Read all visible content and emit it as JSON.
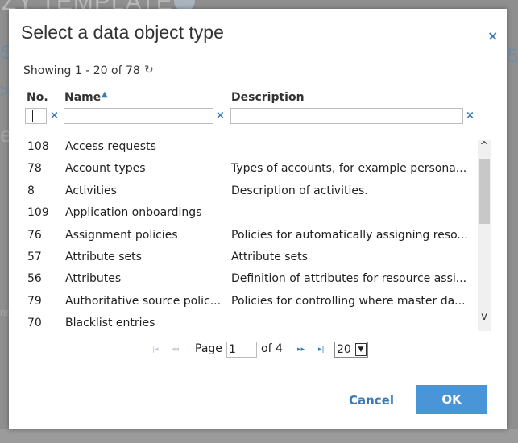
{
  "background": {
    "title_fragment": "ZY TEMPLATE",
    "left_s": "S",
    "left_gt": ">",
    "left_e": "e",
    "left_ns": "ns",
    "right_s": "5"
  },
  "dialog": {
    "title": "Select a data object type",
    "close_glyph": "×",
    "showing": "Showing 1 - 20 of 78",
    "refresh_glyph": "↻",
    "columns": {
      "no": "No.",
      "name": "Name",
      "description": "Description"
    },
    "filter_clear_glyph": "×",
    "rows": [
      {
        "no": "108",
        "name": "Access requests",
        "description": ""
      },
      {
        "no": "78",
        "name": "Account types",
        "description": "Types of accounts, for example persona..."
      },
      {
        "no": "8",
        "name": "Activities",
        "description": "Description of activities."
      },
      {
        "no": "109",
        "name": "Application onboardings",
        "description": ""
      },
      {
        "no": "76",
        "name": "Assignment policies",
        "description": "Policies for automatically assigning reso..."
      },
      {
        "no": "57",
        "name": "Attribute sets",
        "description": "Attribute sets"
      },
      {
        "no": "56",
        "name": "Attributes",
        "description": "Definition of attributes for resource assi..."
      },
      {
        "no": "79",
        "name": "Authoritative source polic...",
        "description": "Policies for controlling where master da..."
      },
      {
        "no": "70",
        "name": "Blacklist entries",
        "description": ""
      }
    ],
    "scroll": {
      "up_glyph": "^",
      "down_glyph": "v"
    },
    "pager": {
      "first_glyph": "|◂",
      "prev_glyph": "◂◂",
      "next_glyph": "▸▸",
      "last_glyph": "▸|",
      "page_label": "Page",
      "page_value": "1",
      "of_label": "of 4",
      "page_size": "20"
    },
    "buttons": {
      "cancel": "Cancel",
      "ok": "OK"
    }
  }
}
